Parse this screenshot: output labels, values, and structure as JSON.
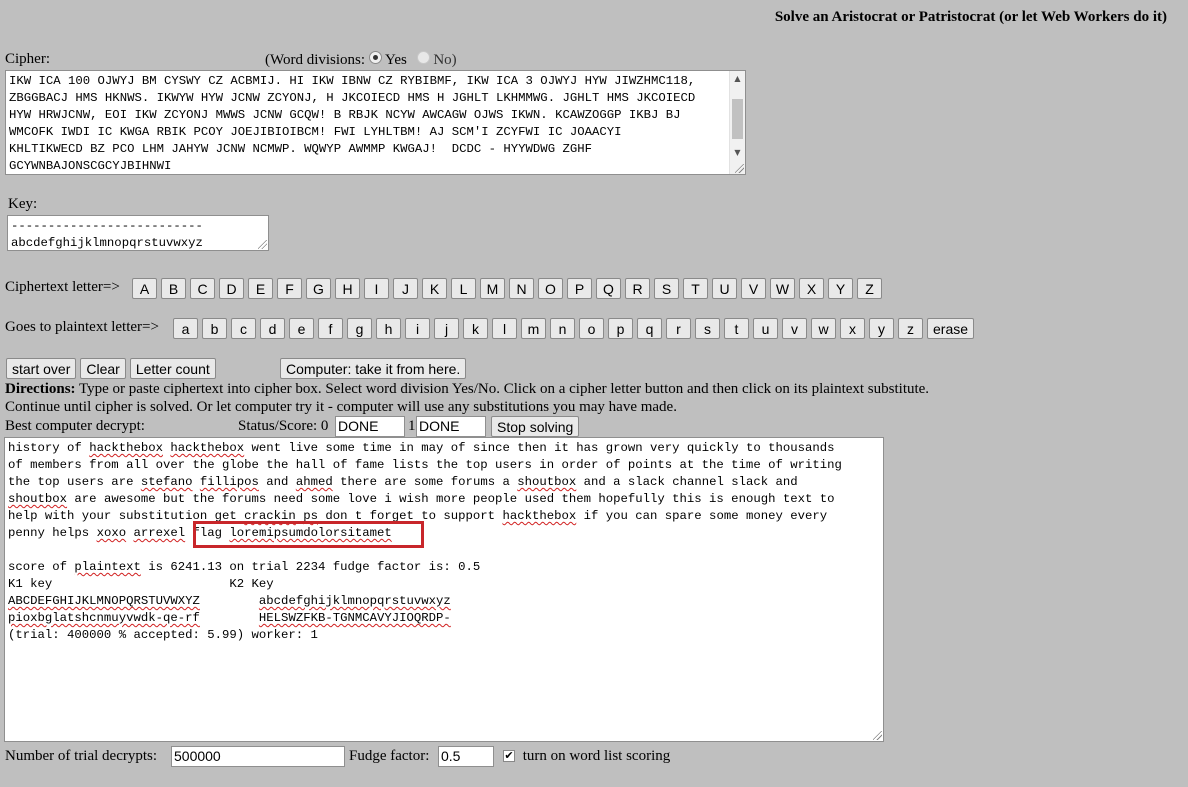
{
  "title": "Solve an Aristocrat or Patristocrat (or let Web Workers do it)",
  "cipher": {
    "label": "Cipher:",
    "word_divisions_label": "(Word divisions:",
    "yes_label": "Yes",
    "no_label": "No)",
    "selected": "Yes",
    "lines": [
      "IKW ICA 100 OJWYJ BM CYSWY CZ ACBMIJ. HI IKW IBNW CZ RYBIBMF, IKW ICA 3 OJWYJ HYW JIWZHMC118,",
      "ZBGGBACJ HMS HKNWS. IKWYW HYW JCNW ZCYONJ, H JKCOIECD HMS H JGHLT LKHMMWG. JGHLT HMS JKCOIECD",
      "HYW HRWJCNW, EOI IKW ZCYONJ MWWS JCNW GCQW! B RBJK NCYW AWCAGW OJWS IKWN. KCAWZOGGP IKBJ BJ",
      "WMCOFK IWDI IC KWGA RBIK PCOY JOEJIBIOIBCM! FWI LYHLTBM! AJ SCM'I ZCYFWI IC JOAACYI",
      "KHLTIKWECD BZ PCO LHM JAHYW JCNW NCMWP. WQWYP AWMMP KWGAJ!  DCDC - HYYWDWG ZGHF",
      "GCYWNBAJONSCGCYJBIHNWI"
    ]
  },
  "key": {
    "label": "Key:",
    "line1": "--------------------------",
    "line2": "abcdefghijklmnopqrstuvwxyz"
  },
  "cipher_letters": {
    "label": "Ciphertext letter=>",
    "letters": [
      "A",
      "B",
      "C",
      "D",
      "E",
      "F",
      "G",
      "H",
      "I",
      "J",
      "K",
      "L",
      "M",
      "N",
      "O",
      "P",
      "Q",
      "R",
      "S",
      "T",
      "U",
      "V",
      "W",
      "X",
      "Y",
      "Z"
    ]
  },
  "plain_letters": {
    "label": "Goes to plaintext letter=>",
    "letters": [
      "a",
      "b",
      "c",
      "d",
      "e",
      "f",
      "g",
      "h",
      "i",
      "j",
      "k",
      "l",
      "m",
      "n",
      "o",
      "p",
      "q",
      "r",
      "s",
      "t",
      "u",
      "v",
      "w",
      "x",
      "y",
      "z"
    ],
    "erase": "erase"
  },
  "actions": {
    "start_over": "start over",
    "clear": "Clear",
    "letter_count": "Letter count",
    "computer": "Computer: take it from here."
  },
  "directions": {
    "bold": "Directions:",
    "line1": " Type or paste ciphertext into cipher box. Select word division Yes/No. Click on a cipher letter button and then click on its plaintext substitute.",
    "line2": "Continue until cipher is solved. Or let computer try it - computer will use any substitutions you may have made."
  },
  "status": {
    "best_label": "Best computer decrypt:",
    "score_label": "Status/Score: 0",
    "field1": "DONE",
    "sep": "1",
    "field2": "DONE",
    "stop": "Stop solving"
  },
  "output": {
    "plaintext": [
      [
        {
          "t": "history of "
        },
        {
          "t": "hackthebox",
          "u": 1
        },
        {
          "t": " "
        },
        {
          "t": "hackthebox",
          "u": 1
        },
        {
          "t": " went live some time in may of since then it has grown very quickly to thousands"
        }
      ],
      [
        {
          "t": "of members from all over the globe the hall of fame lists the top users in order of points at the time of writing"
        }
      ],
      [
        {
          "t": "the top users are "
        },
        {
          "t": "stefano",
          "u": 1
        },
        {
          "t": " "
        },
        {
          "t": "fillipos",
          "u": 1
        },
        {
          "t": " and "
        },
        {
          "t": "ahmed",
          "u": 1
        },
        {
          "t": " there are some forums a "
        },
        {
          "t": "shoutbox",
          "u": 1
        },
        {
          "t": " and a slack channel slack and"
        }
      ],
      [
        {
          "t": "shoutbox",
          "u": 1
        },
        {
          "t": " are awesome but the forums need some love i wish more people used them hopefully this is enough text to"
        }
      ],
      [
        {
          "t": "help with your substitution get "
        },
        {
          "t": "crackin",
          "u": 1
        },
        {
          "t": " "
        },
        {
          "t": "ps",
          "u": 1
        },
        {
          "t": " don t forget to support "
        },
        {
          "t": "hackthebox",
          "u": 1
        },
        {
          "t": " if you can spare some money every"
        }
      ],
      [
        {
          "t": "penny helps "
        },
        {
          "t": "xoxo",
          "u": 1
        },
        {
          "t": " "
        },
        {
          "t": "arrexel",
          "u": 1
        },
        {
          "t": " flag "
        },
        {
          "t": "loremipsumdolorsitamet",
          "u": 1
        }
      ]
    ],
    "score_line": [
      {
        "t": "score of "
      },
      {
        "t": "plaintext",
        "u": 1
      },
      {
        "t": " is 6241.13 on trial 2234 fudge factor is: 0.5"
      }
    ],
    "k1_label": "K1 key",
    "k2_label": "K2 Key",
    "k1_alpha": "ABCDEFGHIJKLMNOPQRSTUVWXYZ",
    "k2_alpha": "abcdefghijklmnopqrstuvwxyz",
    "k1_key": "pioxbglatshcnmuyvwdk-qe-rf",
    "k2_key": "HELSWZFKB-TGNMCAVYJIOQRDP-",
    "trial_line": "(trial: 400000 % accepted: 5.99) worker: 1"
  },
  "bottom": {
    "trials_label": "Number of trial decrypts:",
    "trials_value": "500000",
    "fudge_label": "Fudge factor:",
    "fudge_value": "0.5",
    "wordlist_label": "turn on word list scoring",
    "wordlist_checked": true
  },
  "colors": {
    "background": "#bfbfbf",
    "highlight": "#c8262a",
    "spell_underline": "#d12020"
  }
}
